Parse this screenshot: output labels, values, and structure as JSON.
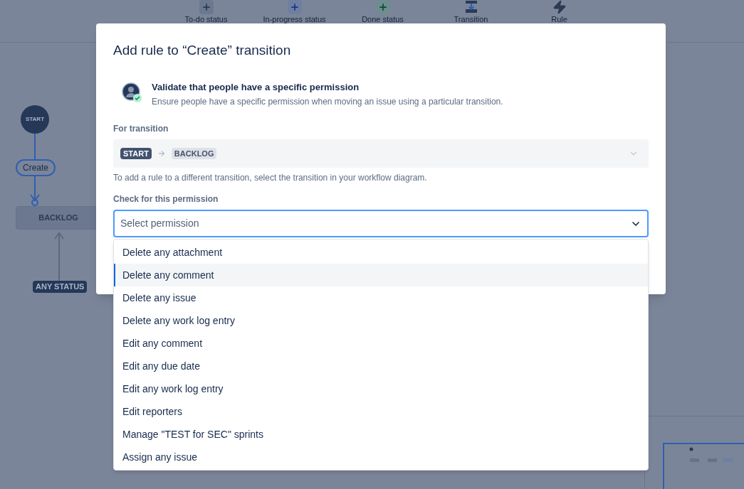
{
  "toolbar": {
    "items": [
      {
        "kind": "todo",
        "label": "To-do status"
      },
      {
        "kind": "inprogress",
        "label": "In-progress status"
      },
      {
        "kind": "done",
        "label": "Done status"
      },
      {
        "kind": "transition",
        "label": "Transition"
      },
      {
        "kind": "rule",
        "label": "Rule"
      }
    ]
  },
  "diagram": {
    "start": "START",
    "transition": "Create",
    "status": "BACKLOG",
    "any_status": "ANY STATUS"
  },
  "modal": {
    "title": "Add rule to “Create” transition",
    "rule": {
      "title": "Validate that people have a specific permission",
      "description": "Ensure people have a specific permission when moving an issue using a particular transition."
    },
    "transition_field": {
      "label": "For transition",
      "from": "START",
      "to": "BACKLOG"
    },
    "help": "To add a rule to a different transition, select the transition in your workflow diagram.",
    "permission_field": {
      "label": "Check for this permission",
      "placeholder": "Select permission"
    },
    "options": [
      {
        "label": "Delete any attachment",
        "selected": false
      },
      {
        "label": "Delete any comment",
        "selected": true
      },
      {
        "label": "Delete any issue",
        "selected": false
      },
      {
        "label": "Delete any work log entry",
        "selected": false
      },
      {
        "label": "Edit any comment",
        "selected": false
      },
      {
        "label": "Edit any due date",
        "selected": false
      },
      {
        "label": "Edit any work log entry",
        "selected": false
      },
      {
        "label": "Edit reporters",
        "selected": false
      },
      {
        "label": "Manage \"TEST for SEC\" sprints",
        "selected": false
      },
      {
        "label": "Assign any issue",
        "selected": false
      }
    ]
  }
}
